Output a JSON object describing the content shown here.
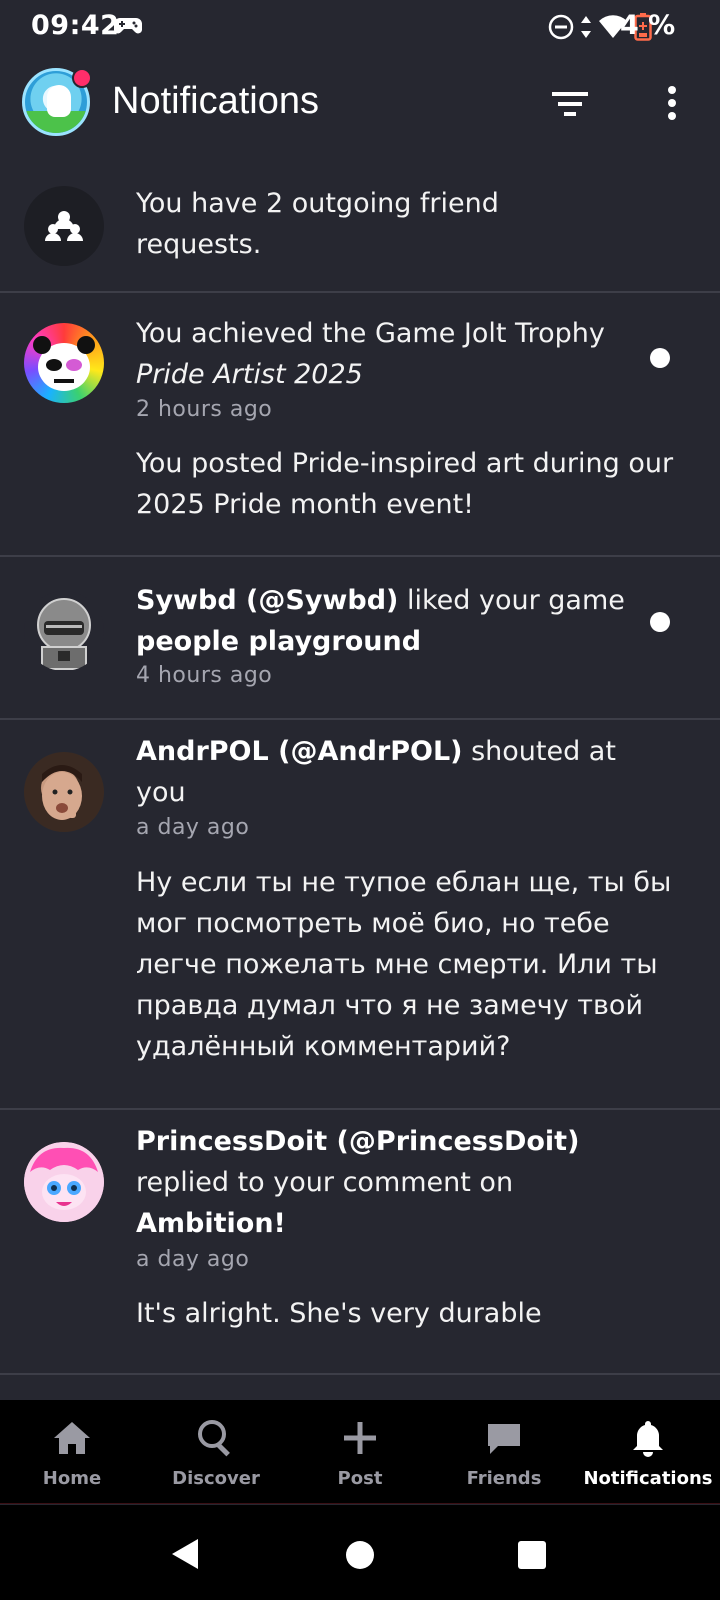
{
  "status_bar": {
    "time": "09:42",
    "battery_percent": "4 %",
    "icons": [
      "gamepad-icon",
      "do-not-disturb-icon",
      "data-arrows-icon",
      "wifi-icon",
      "battery-low-icon"
    ]
  },
  "header": {
    "title": "Notifications",
    "icons": [
      "filter-icon",
      "more-vert-icon"
    ]
  },
  "notifications": [
    {
      "type": "friend_requests",
      "text": "You have 2 outgoing friend requests.",
      "icon": "friends-icon"
    },
    {
      "type": "trophy",
      "text_prefix": "You achieved the Game Jolt Trophy",
      "trophy_name": "Pride Artist 2025",
      "time": "2 hours ago",
      "body": "You posted Pride-inspired art during our 2025 Pride month event!",
      "unread": true
    },
    {
      "type": "like",
      "user": "Sywbd (@Sywbd)",
      "action": " liked your game ",
      "target": "people playground",
      "time": "4 hours ago",
      "unread": true
    },
    {
      "type": "shout",
      "user": "AndrPOL (@AndrPOL)",
      "action": " shouted at you",
      "time": "a day ago",
      "body": "Ну если ты не тупое еблан ще, ты бы мог посмотреть моё био, но тебе легче пожелать мне смерти. Или ты правда думал что я не замечу твой удалённый комментарий?"
    },
    {
      "type": "reply",
      "user": "PrincessDoit (@PrincessDoit)",
      "action": "replied to your comment on ",
      "target": "Ambition!",
      "time": "a day ago",
      "body": "It's alright. She's very durable"
    }
  ],
  "bottom_nav": [
    {
      "label": "Home",
      "icon": "home-icon"
    },
    {
      "label": "Discover",
      "icon": "search-icon"
    },
    {
      "label": "Post",
      "icon": "plus-icon"
    },
    {
      "label": "Friends",
      "icon": "chat-bubble-icon"
    },
    {
      "label": "Notifications",
      "icon": "bell-icon",
      "active": true
    }
  ],
  "colors": {
    "background": "#262730",
    "divider": "#3d3e48",
    "nav_background": "#000000",
    "badge": "#ff2e6a",
    "muted_text": "#a5a6b0"
  }
}
